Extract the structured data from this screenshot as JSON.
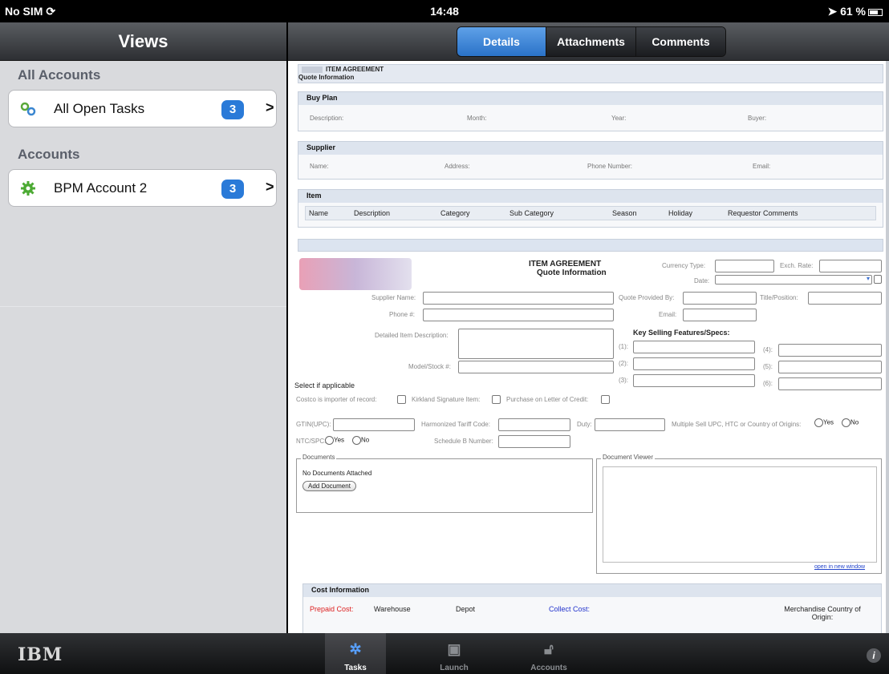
{
  "status": {
    "carrier": "No SIM",
    "time": "14:48",
    "battery": "61 %"
  },
  "sidebar": {
    "title": "Views",
    "sections": [
      {
        "title": "All Accounts",
        "item": {
          "label": "All Open Tasks",
          "count": "3",
          "icon": "link-icon"
        }
      },
      {
        "title": "Accounts",
        "item": {
          "label": "BPM Account 2",
          "count": "3",
          "icon": "gear-icon"
        }
      }
    ]
  },
  "tabs": [
    "Details",
    "Attachments",
    "Comments"
  ],
  "doc": {
    "top_title": "ITEM AGREEMENT",
    "top_subtitle": "Quote Information",
    "buy_plan": {
      "title": "Buy Plan",
      "fields": [
        "Description:",
        "Month:",
        "Year:",
        "Buyer:"
      ]
    },
    "supplier": {
      "title": "Supplier",
      "fields": [
        "Name:",
        "Address:",
        "Phone Number:",
        "Email:"
      ]
    },
    "item": {
      "title": "Item",
      "columns": [
        "Name",
        "Description",
        "Category",
        "Sub Category",
        "Season",
        "Holiday",
        "Requestor Comments"
      ]
    },
    "form": {
      "title": "ITEM AGREEMENT",
      "subtitle": "Quote Information",
      "currency_type": "Currency Type:",
      "exch_rate": "Exch. Rate:",
      "date": "Date:",
      "supplier_name": "Supplier Name:",
      "quote_provided_by": "Quote Provided By:",
      "title_position": "Title/Position:",
      "phone": "Phone #:",
      "email": "Email:",
      "detailed_desc": "Detailed Item Description:",
      "key_selling": "Key Selling Features/Specs:",
      "model_stock": "Model/Stock #:",
      "ks_nums": [
        "(1):",
        "(2):",
        "(3):",
        "(4):",
        "(5):",
        "(6):"
      ],
      "select_applicable": "Select if applicable",
      "check1": "Costco is importer of record:",
      "check2": "Kirkland Signature Item:",
      "check3": "Purchase on Letter of Credit:",
      "gtin": "GTIN(UPC):",
      "tariff": "Harmonized Tariff Code:",
      "duty": "Duty:",
      "multiple": "Multiple Sell UPC, HTC or Country of Origins:",
      "yes": "Yes",
      "no": "No",
      "ntc": "NTC/SPC:",
      "schedule_b": "Schedule B Number:",
      "documents": "Documents",
      "no_docs": "No Documents Attached",
      "add_doc": "Add Document",
      "doc_viewer": "Document Viewer",
      "open_new": "open in new window",
      "cost_info": "Cost Information",
      "prepaid": "Prepaid Cost:",
      "warehouse": "Warehouse",
      "depot": "Depot",
      "collect": "Collect Cost:",
      "merch": "Merchandise Country of Origin:"
    }
  },
  "tabbar": {
    "brand": "IBM",
    "items": [
      "Tasks",
      "Launch",
      "Accounts"
    ],
    "help": "i"
  }
}
